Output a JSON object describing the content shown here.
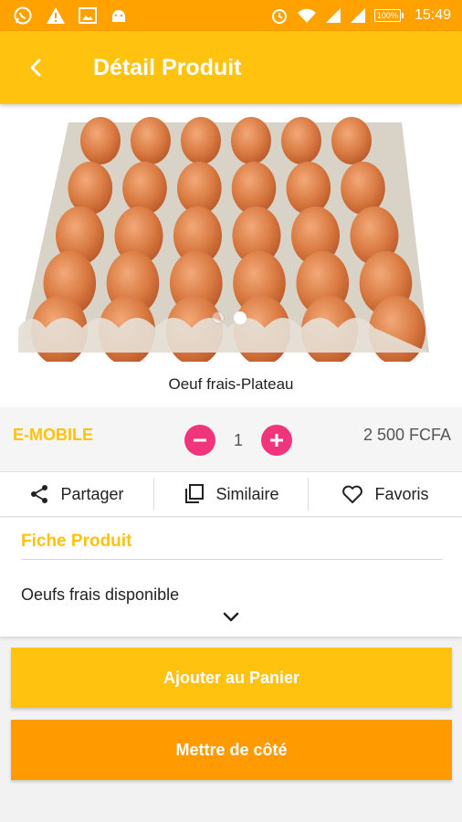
{
  "status_bar": {
    "time": "15:49",
    "battery": "100%",
    "left_icons": [
      "whatsapp-icon",
      "warning-icon",
      "image-icon",
      "android-icon"
    ],
    "right_icons": [
      "alarm-icon",
      "wifi-icon",
      "signal-icon",
      "signal-icon",
      "battery-icon"
    ]
  },
  "app_bar": {
    "title": "Détail Produit",
    "back_icon": "arrow-back-icon"
  },
  "gallery": {
    "image": "eggs-tray-photo",
    "page_count": 2,
    "active_page": 2
  },
  "product": {
    "name": "Oeuf frais-Plateau",
    "seller": "E-MOBILE",
    "quantity": "1",
    "price": "2 500 FCFA"
  },
  "actions": {
    "share": "Partager",
    "similar": "Similaire",
    "favorites": "Favoris"
  },
  "fiche": {
    "title": "Fiche Produit",
    "description": "Oeufs frais disponible"
  },
  "buttons": {
    "add_to_cart": "Ajouter au Panier",
    "set_aside": "Mettre de côté"
  },
  "colors": {
    "status_bar": "#ffa200",
    "app_bar": "#ffc20e",
    "accent": "#ffc20e",
    "quantity_button": "#f0357d",
    "secondary_button": "#ff9b00"
  }
}
